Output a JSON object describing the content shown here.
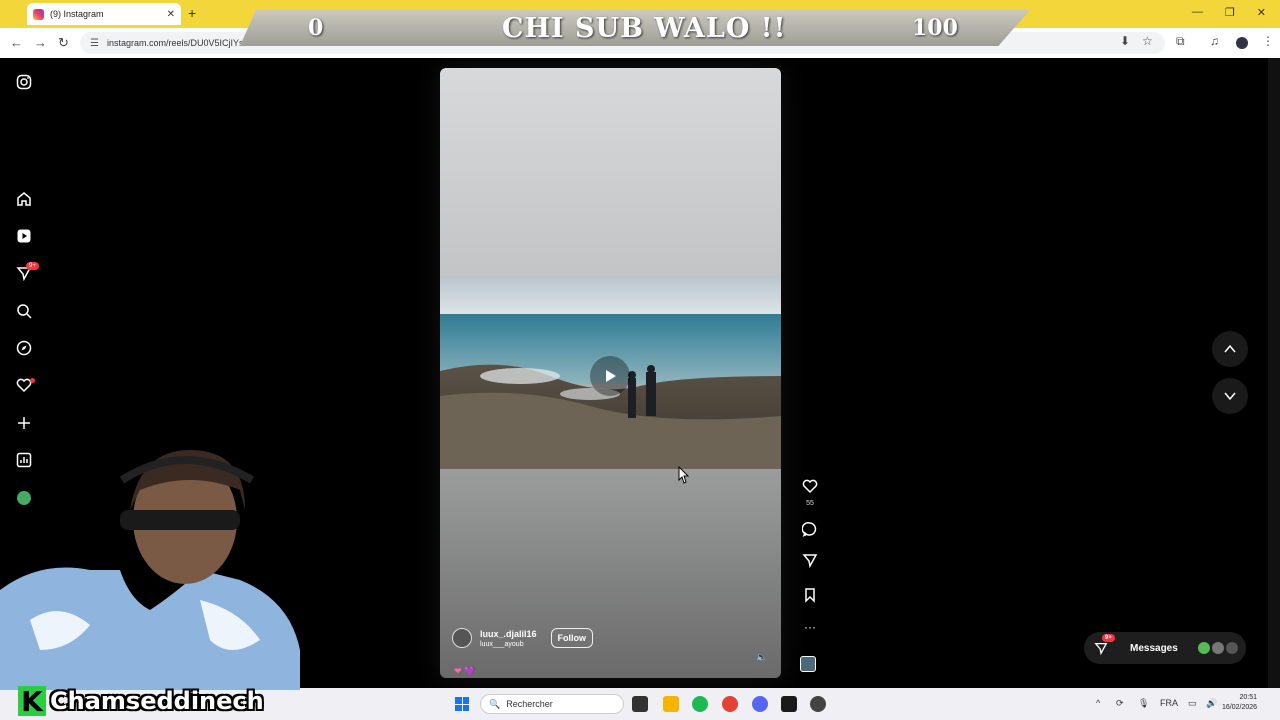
{
  "browser": {
    "tab_title": "(9) Instagram",
    "tab_close": "✕",
    "new_tab": "+",
    "url": "instagram.com/reels/DU0V5ICjIYs/",
    "window_buttons": [
      "—",
      "❐",
      "✕"
    ]
  },
  "overlay": {
    "left_number": "0",
    "title": "CHI SUB WALO !!",
    "right_number": "100",
    "streamer_initial": "K",
    "streamer_name": "Chamseddinech"
  },
  "sidebar": {
    "icons": [
      "instagram-icon",
      "home-icon",
      "reels-icon",
      "direct-icon",
      "search-icon",
      "explore-icon",
      "heart-icon",
      "create-icon",
      "dashboard-icon",
      "profile-avatar",
      "menu-icon"
    ],
    "notification_badge": "9+"
  },
  "reel": {
    "username": "luux_.djalil16",
    "audio_user": "luux___ayoub",
    "follow_label": "Follow",
    "like_count": "55",
    "emojis": "❤ 💜",
    "sound_icon": "🔈"
  },
  "messages": {
    "label": "Messages",
    "badge": "9+"
  },
  "taskbar": {
    "search_placeholder": "Rechercher",
    "lang": "FRA",
    "time": "20:51",
    "date": "16/02/2026"
  },
  "colors": {
    "browser_accent": "#f3d73a",
    "notification_red": "#ff3040",
    "page_bg": "#000000"
  }
}
